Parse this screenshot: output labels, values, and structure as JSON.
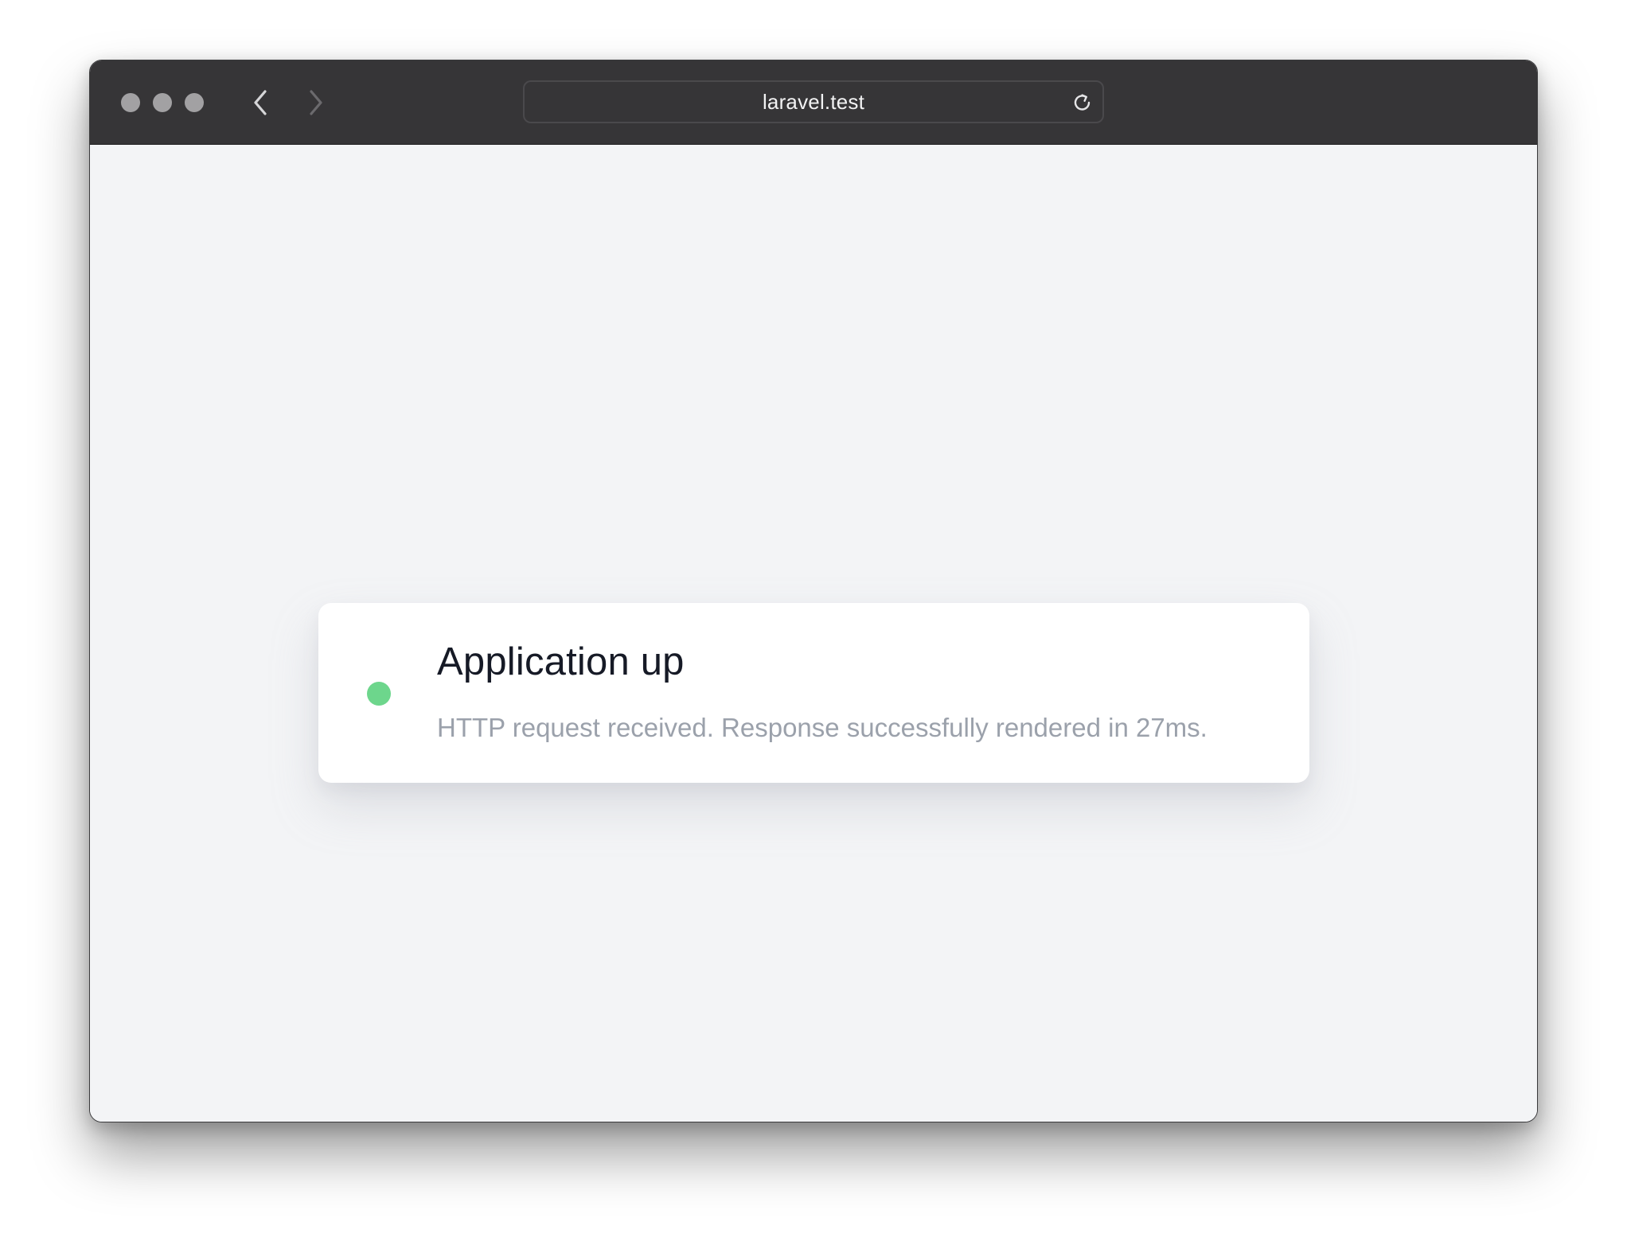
{
  "browser": {
    "url": "laravel.test",
    "icons": {
      "back": "chevron-left-icon",
      "forward": "chevron-right-icon",
      "reload": "reload-icon"
    }
  },
  "status_card": {
    "title": "Application up",
    "message": "HTTP request received. Response successfully rendered in 27ms.",
    "status_color": "#6dd68c"
  }
}
